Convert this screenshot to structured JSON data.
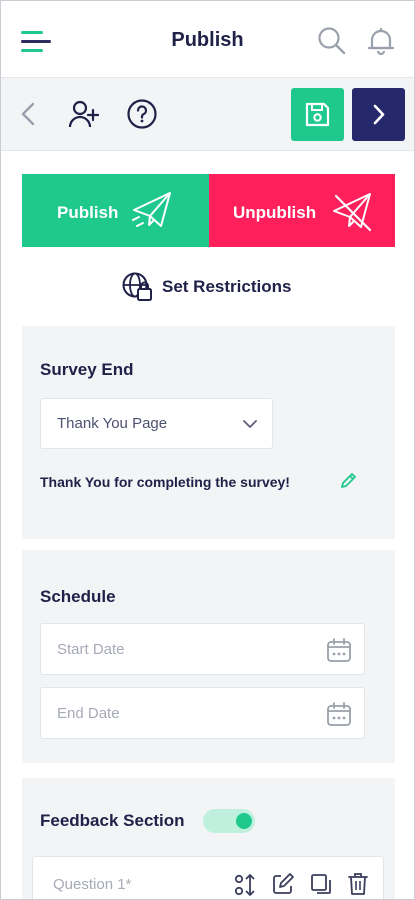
{
  "header": {
    "title": "Publish",
    "icons": [
      "hamburger-menu-icon",
      "search-icon",
      "bell-icon"
    ]
  },
  "toolbar": {
    "icons": [
      "back-chevron-icon",
      "add-user-icon",
      "help-icon",
      "save-icon",
      "next-chevron-icon"
    ]
  },
  "actions": {
    "publish_label": "Publish",
    "unpublish_label": "Unpublish",
    "restrictions_label": "Set Restrictions"
  },
  "survey_end": {
    "title": "Survey End",
    "selected": "Thank You Page",
    "message": "Thank You for completing the survey!"
  },
  "schedule": {
    "title": "Schedule",
    "start_placeholder": "Start Date",
    "end_placeholder": "End Date"
  },
  "feedback": {
    "title": "Feedback Section",
    "enabled": true,
    "question_placeholder": "Question 1*"
  },
  "colors": {
    "accent_green": "#1fc98e",
    "accent_red": "#ff1f5a",
    "navy": "#25286a",
    "panel": "#f2f4f6"
  }
}
